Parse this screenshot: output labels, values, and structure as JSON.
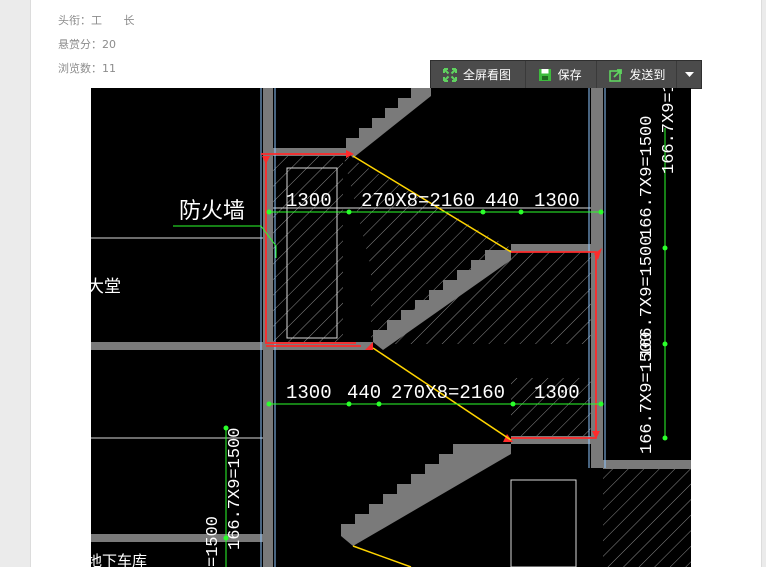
{
  "meta": {
    "title_label": "头衔：工",
    "title_value": "长",
    "reward": "悬赏分：20",
    "views": "浏览数：11"
  },
  "toolbar": {
    "fullscreen": "全屏看图",
    "save": "保存",
    "send": "发送到"
  },
  "drawing": {
    "dim_top": [
      "1300",
      "270X8=2160",
      "440",
      "1300"
    ],
    "dim_bottom": [
      "1300",
      "440",
      "270X8=2160",
      "1300"
    ],
    "firewall": "防火墙",
    "lobby": "大堂",
    "basement": "地下车库",
    "right_dim_1": "166.7X9=1500",
    "right_dim_2": "166.7X9=1500",
    "right_dim_3": "166.7X9=1500",
    "right_dim_4": "166.7X9=1500",
    "left_dim_1": "166.7X9=1500",
    "left_dim_2": "=1500"
  }
}
